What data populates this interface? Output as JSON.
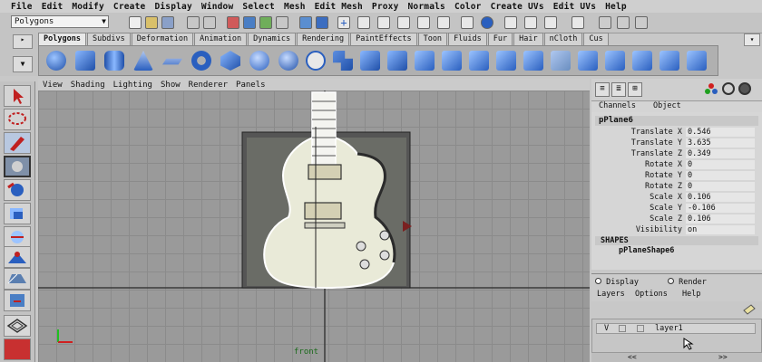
{
  "menubar": [
    "File",
    "Edit",
    "Modify",
    "Create",
    "Display",
    "Window",
    "Select",
    "Mesh",
    "Edit Mesh",
    "Proxy",
    "Normals",
    "Color",
    "Create UVs",
    "Edit UVs",
    "Help"
  ],
  "status": {
    "menu_set": "Polygons"
  },
  "shelf_tabs": [
    "Polygons",
    "Subdivs",
    "Deformation",
    "Animation",
    "Dynamics",
    "Rendering",
    "PaintEffects",
    "Toon",
    "Fluids",
    "Fur",
    "Hair",
    "nCloth",
    "Cus"
  ],
  "viewport": {
    "menu": [
      "View",
      "Shading",
      "Lighting",
      "Show",
      "Renderer",
      "Panels"
    ],
    "camera_label": "front"
  },
  "channel_box": {
    "menu": [
      "Channels",
      "Object"
    ],
    "object_name": "pPlane6",
    "attributes": [
      {
        "label": "Translate X",
        "value": "0.546"
      },
      {
        "label": "Translate Y",
        "value": "3.635"
      },
      {
        "label": "Translate Z",
        "value": "0.349"
      },
      {
        "label": "Rotate X",
        "value": "0"
      },
      {
        "label": "Rotate Y",
        "value": "0"
      },
      {
        "label": "Rotate Z",
        "value": "0"
      },
      {
        "label": "Scale X",
        "value": "0.106"
      },
      {
        "label": "Scale Y",
        "value": "-0.106"
      },
      {
        "label": "Scale Z",
        "value": "0.106"
      },
      {
        "label": "Visibility",
        "value": "on"
      }
    ],
    "shapes_header": "SHAPES",
    "shape_name": "pPlaneShape6"
  },
  "layers": {
    "display_label": "Display",
    "render_label": "Render",
    "menu": [
      "Layers",
      "Options",
      "Help"
    ],
    "layer_v": "V",
    "layer_name": "layer1"
  },
  "colors": {
    "accent": "#2a5fbf",
    "viewport_bg": "#9a9a9a",
    "highlight": "#ffffff"
  }
}
